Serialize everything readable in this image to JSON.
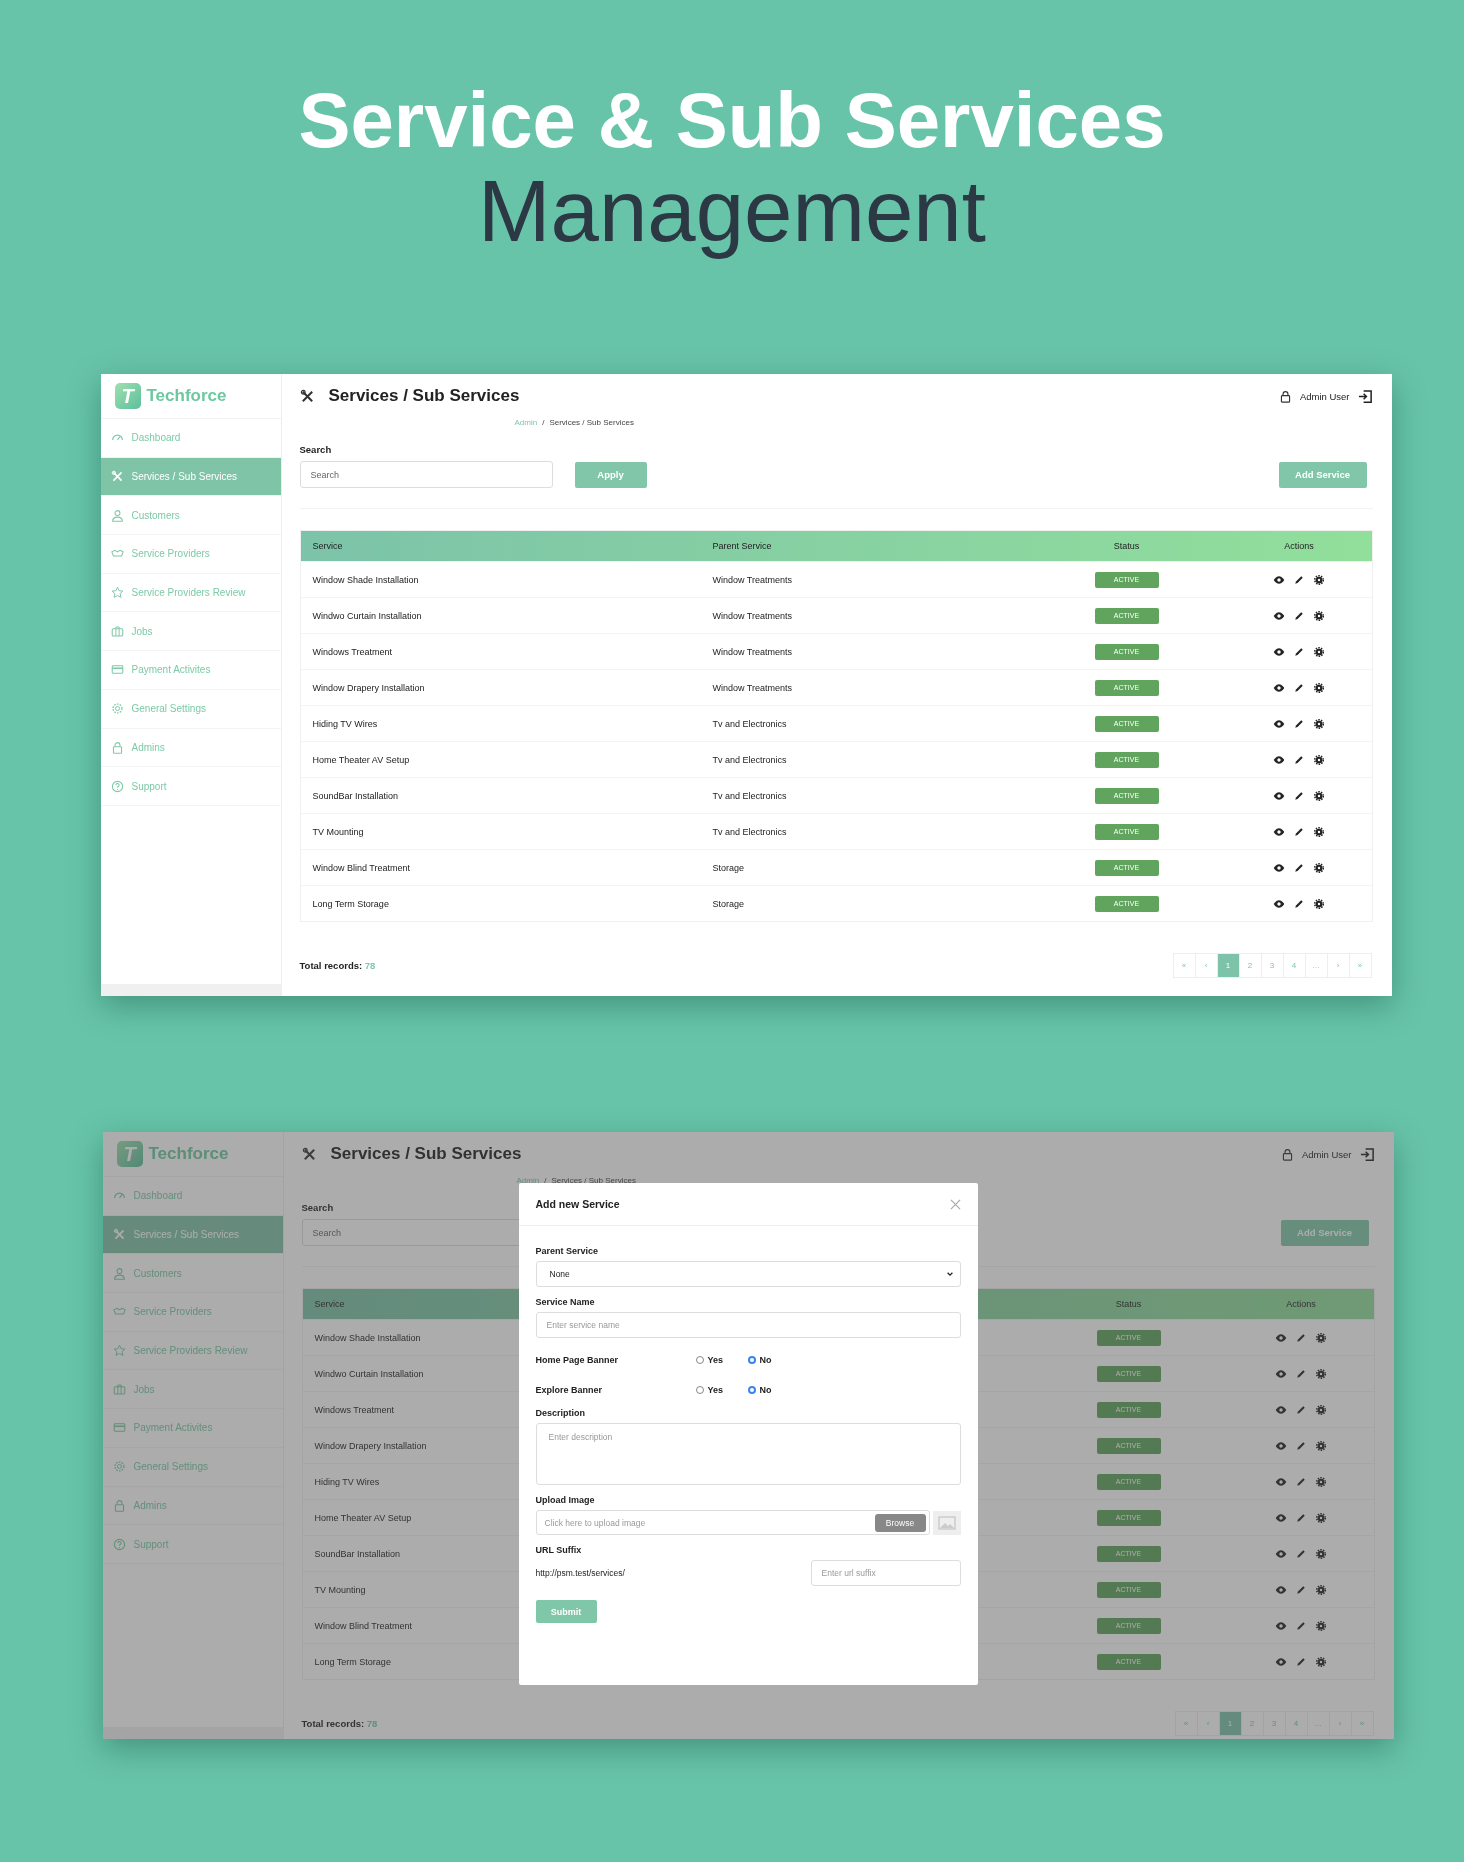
{
  "headline": {
    "title": "Service & Sub Services",
    "subtitle": "Management"
  },
  "screens": [
    {
      "brand": {
        "logo_letter": "T",
        "name": "Techforce"
      },
      "sidebar": {
        "items": [
          {
            "label": "Dashboard",
            "selected": false
          },
          {
            "label": "Services / Sub Services",
            "selected": true
          },
          {
            "label": "Customers",
            "selected": false
          },
          {
            "label": "Service Providers",
            "selected": false
          },
          {
            "label": "Service Providers Review",
            "selected": false
          },
          {
            "label": "Jobs",
            "selected": false
          },
          {
            "label": "Payment Activites",
            "selected": false
          },
          {
            "label": "General Settings",
            "selected": false
          },
          {
            "label": "Admins",
            "selected": false
          },
          {
            "label": "Support",
            "selected": false
          }
        ]
      },
      "page_title": "Services / Sub Services",
      "breadcrumb": [
        "Admin",
        "/",
        "Services / Sub Services"
      ],
      "user": "Admin User",
      "search": {
        "label": "Search",
        "placeholder": "Search"
      },
      "apply_button": "Apply",
      "add_button": "Add Service",
      "table": {
        "columns": [
          {
            "kind": "service",
            "label": "Service"
          },
          {
            "kind": "parent",
            "label": "Parent Service"
          },
          {
            "kind": "status",
            "label": "Status"
          },
          {
            "kind": "actions",
            "label": "Actions"
          }
        ],
        "rows": [
          {
            "service": "Window Shade Installation",
            "parent": "Window Treatments",
            "status": "ACTIVE"
          },
          {
            "service": "Windwo Curtain Installation",
            "parent": "Window Treatments",
            "status": "ACTIVE"
          },
          {
            "service": "Windows Treatment",
            "parent": "Window Treatments",
            "status": "ACTIVE"
          },
          {
            "service": "Window Drapery Installation",
            "parent": "Window Treatments",
            "status": "ACTIVE"
          },
          {
            "service": "Hiding TV Wires",
            "parent": "Tv and Electronics",
            "status": "ACTIVE"
          },
          {
            "service": "Home Theater AV Setup",
            "parent": "Tv and Electronics",
            "status": "ACTIVE"
          },
          {
            "service": "SoundBar Installation",
            "parent": "Tv and Electronics",
            "status": "ACTIVE"
          },
          {
            "service": "TV Mounting",
            "parent": "Tv and Electronics",
            "status": "ACTIVE"
          },
          {
            "service": "Window Blind Treatment",
            "parent": "Storage",
            "status": "ACTIVE"
          },
          {
            "service": "Long Term Storage",
            "parent": "Storage",
            "status": "ACTIVE"
          }
        ]
      },
      "total": {
        "label": "Total records:",
        "value": "78"
      },
      "pagination": [
        {
          "label": "«",
          "selected": false
        },
        {
          "label": "‹",
          "selected": false
        },
        {
          "label": "1",
          "selected": true
        },
        {
          "label": "2",
          "selected": false
        },
        {
          "label": "3",
          "selected": false
        },
        {
          "label": "4",
          "selected": false
        },
        {
          "label": "…",
          "selected": false
        },
        {
          "label": "›",
          "selected": false
        },
        {
          "label": "»",
          "selected": false
        }
      ],
      "dimmed": false
    },
    {
      "brand": {
        "logo_letter": "T",
        "name": "Techforce"
      },
      "sidebar": {
        "items": [
          {
            "label": "Dashboard",
            "selected": false
          },
          {
            "label": "Services / Sub Services",
            "selected": true
          },
          {
            "label": "Customers",
            "selected": false
          },
          {
            "label": "Service Providers",
            "selected": false
          },
          {
            "label": "Service Providers Review",
            "selected": false
          },
          {
            "label": "Jobs",
            "selected": false
          },
          {
            "label": "Payment Activites",
            "selected": false
          },
          {
            "label": "General Settings",
            "selected": false
          },
          {
            "label": "Admins",
            "selected": false
          },
          {
            "label": "Support",
            "selected": false
          }
        ]
      },
      "page_title": "Services / Sub Services",
      "breadcrumb": [
        "Admin",
        "/",
        "Services / Sub Services"
      ],
      "user": "Admin User",
      "search": {
        "label": "Search",
        "placeholder": "Search"
      },
      "add_button": "Add Service",
      "table": {
        "columns": [
          {
            "kind": "service",
            "label": "Service"
          },
          {
            "kind": "status",
            "label": "Status"
          },
          {
            "kind": "actions",
            "label": "Actions"
          }
        ],
        "rows": [
          {
            "service": "Window Shade Installation",
            "status": "ACTIVE"
          },
          {
            "service": "Windwo Curtain Installation",
            "status": "ACTIVE"
          },
          {
            "service": "Windows Treatment",
            "status": "ACTIVE"
          },
          {
            "service": "Window Drapery Installation",
            "status": "ACTIVE"
          },
          {
            "service": "Hiding TV Wires",
            "status": "ACTIVE"
          },
          {
            "service": "Home Theater AV Setup",
            "status": "ACTIVE"
          },
          {
            "service": "SoundBar Installation",
            "status": "ACTIVE"
          },
          {
            "service": "TV Mounting",
            "status": "ACTIVE"
          },
          {
            "service": "Window Blind Treatment",
            "status": "ACTIVE"
          },
          {
            "service": "Long Term Storage",
            "status": "ACTIVE"
          }
        ]
      },
      "total": {
        "label": "Total records:",
        "value": "78"
      },
      "pagination": [
        {
          "label": "«",
          "selected": false
        },
        {
          "label": "‹",
          "selected": false
        },
        {
          "label": "1",
          "selected": true
        },
        {
          "label": "2",
          "selected": false
        },
        {
          "label": "3",
          "selected": false
        },
        {
          "label": "4",
          "selected": false
        },
        {
          "label": "…",
          "selected": false
        },
        {
          "label": "›",
          "selected": false
        },
        {
          "label": "»",
          "selected": false
        }
      ],
      "dimmed": true,
      "modal": {
        "title": "Add new Service",
        "parent_service": {
          "label": "Parent Service",
          "value": "None"
        },
        "service_name": {
          "label": "Service Name",
          "placeholder": "Enter service name"
        },
        "radio_groups": [
          {
            "label": "Home Page Banner",
            "options": [
              {
                "label": "Yes",
                "selected": false
              },
              {
                "label": "No",
                "selected": true
              }
            ]
          },
          {
            "label": "Explore Banner",
            "options": [
              {
                "label": "Yes",
                "selected": false
              },
              {
                "label": "No",
                "selected": true
              }
            ]
          }
        ],
        "description": {
          "label": "Description",
          "placeholder": "Enter description"
        },
        "upload": {
          "label": "Upload Image",
          "placeholder": "Click here to upload image",
          "button": "Browse"
        },
        "url_suffix": {
          "label": "URL Suffix",
          "prefix": "http://psm.test/services/",
          "placeholder": "Enter url suffix"
        },
        "submit": "Submit"
      }
    }
  ]
}
